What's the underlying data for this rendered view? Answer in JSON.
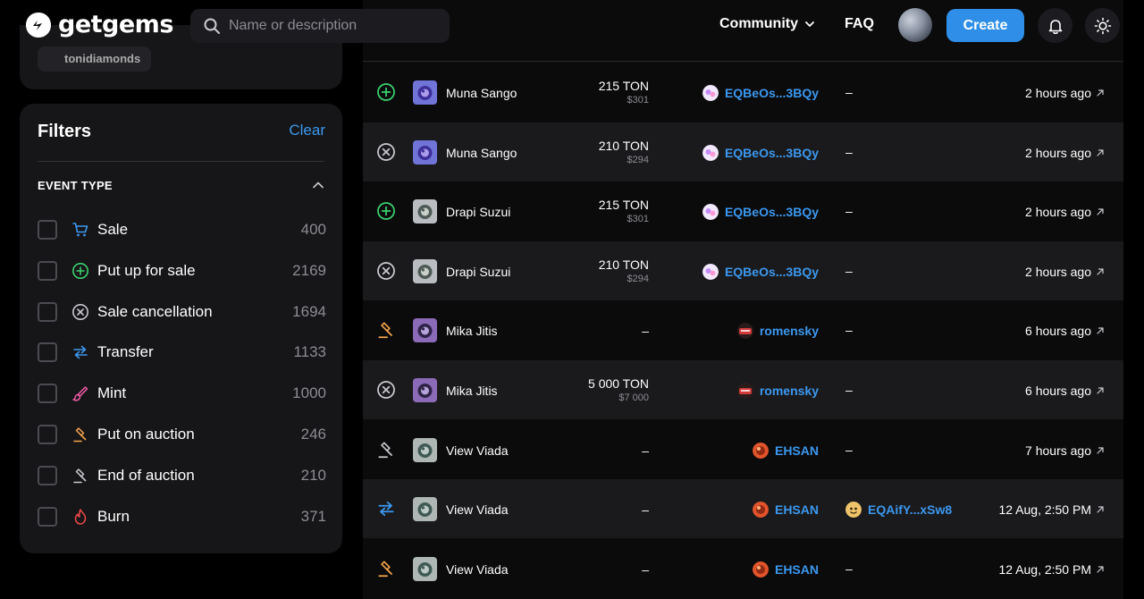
{
  "header": {
    "brand": "getgems",
    "search_placeholder": "Name or description",
    "community_label": "Community",
    "faq_label": "FAQ",
    "create_label": "Create"
  },
  "user_card": {
    "chip_text": "tonidiamonds"
  },
  "filters": {
    "title": "Filters",
    "clear_label": "Clear",
    "section_title": "EVENT TYPE",
    "items": [
      {
        "label": "Sale",
        "count": "400",
        "icon": "cart-icon",
        "color": "#3b98ef"
      },
      {
        "label": "Put up for sale",
        "count": "2169",
        "icon": "plus-circle-icon",
        "color": "#3bd16f"
      },
      {
        "label": "Sale cancellation",
        "count": "1694",
        "icon": "x-circle-icon",
        "color": "#c9c9cf"
      },
      {
        "label": "Transfer",
        "count": "1133",
        "icon": "transfer-arrows-icon",
        "color": "#3b98ef"
      },
      {
        "label": "Mint",
        "count": "1000",
        "icon": "brush-icon",
        "color": "#f35ba8"
      },
      {
        "label": "Put on auction",
        "count": "246",
        "icon": "gavel-icon",
        "color": "#f5a34a"
      },
      {
        "label": "End of auction",
        "count": "210",
        "icon": "gavel-icon",
        "color": "#c9c9cf"
      },
      {
        "label": "Burn",
        "count": "371",
        "icon": "flame-icon",
        "color": "#f24848"
      }
    ]
  },
  "table": {
    "rows": [
      {
        "event": "plus",
        "thumb": "purple",
        "name": "Muna Sango",
        "ton": "215 TON",
        "usd": "$301",
        "from": "EQBeOs...3BQy",
        "from_av": "pink",
        "to": "–",
        "time": "2 hours ago"
      },
      {
        "event": "x",
        "thumb": "purple",
        "name": "Muna Sango",
        "ton": "210 TON",
        "usd": "$294",
        "from": "EQBeOs...3BQy",
        "from_av": "pink",
        "to": "–",
        "time": "2 hours ago"
      },
      {
        "event": "plus",
        "thumb": "grey",
        "name": "Drapi Suzui",
        "ton": "215 TON",
        "usd": "$301",
        "from": "EQBeOs...3BQy",
        "from_av": "pink",
        "to": "–",
        "time": "2 hours ago"
      },
      {
        "event": "x",
        "thumb": "grey",
        "name": "Drapi Suzui",
        "ton": "210 TON",
        "usd": "$294",
        "from": "EQBeOs...3BQy",
        "from_av": "pink",
        "to": "–",
        "time": "2 hours ago"
      },
      {
        "event": "auction",
        "thumb": "violet",
        "name": "Mika Jitis",
        "ton": "–",
        "usd": "",
        "from": "romensky",
        "from_av": "red",
        "to": "–",
        "time": "6 hours ago"
      },
      {
        "event": "x",
        "thumb": "violet",
        "name": "Mika Jitis",
        "ton": "5 000 TON",
        "usd": "$7 000",
        "from": "romensky",
        "from_av": "red",
        "to": "–",
        "time": "6 hours ago"
      },
      {
        "event": "end-auction",
        "thumb": "teal",
        "name": "View Viada",
        "ton": "–",
        "usd": "",
        "from": "EHSAN",
        "from_av": "orange",
        "to": "–",
        "time": "7 hours ago"
      },
      {
        "event": "transfer",
        "thumb": "teal",
        "name": "View Viada",
        "ton": "–",
        "usd": "",
        "from": "EHSAN",
        "from_av": "orange",
        "to": "EQAifY...xSw8",
        "time": "12 Aug, 2:50 PM"
      },
      {
        "event": "auction",
        "thumb": "teal",
        "name": "View Viada",
        "ton": "–",
        "usd": "",
        "from": "EHSAN",
        "from_av": "orange",
        "to": "–",
        "time": "12 Aug, 2:50 PM"
      }
    ]
  }
}
